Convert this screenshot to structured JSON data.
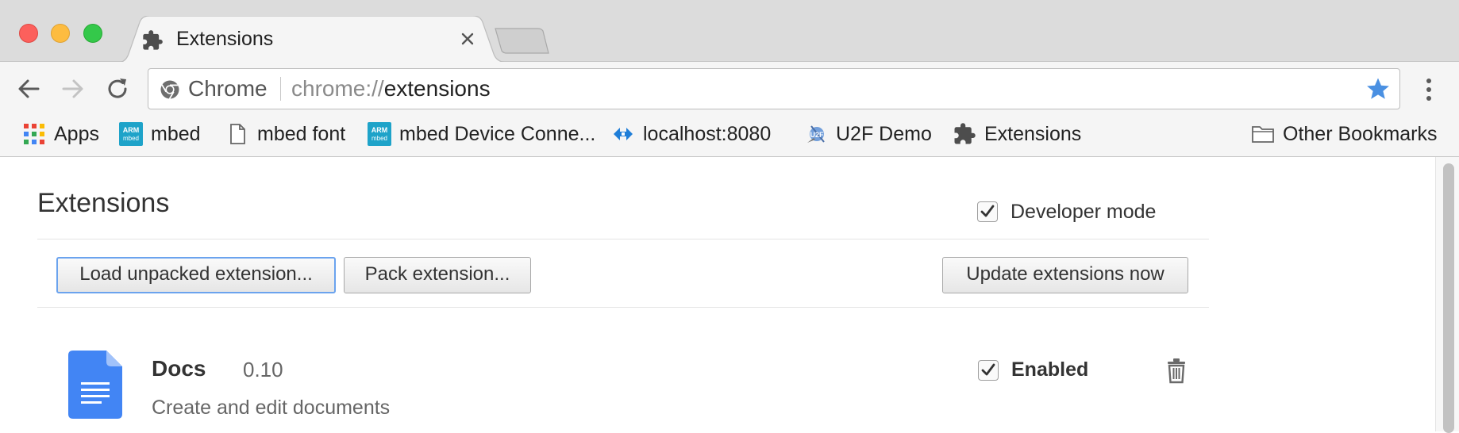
{
  "window": {
    "tab_title": "Extensions"
  },
  "toolbar": {
    "omnibox_chip": "Chrome",
    "url_scheme": "chrome://",
    "url_host": "extensions"
  },
  "bookmarks": [
    {
      "label": "Apps",
      "icon": "apps-grid-icon"
    },
    {
      "label": "mbed",
      "icon": "arm-mbed-icon"
    },
    {
      "label": "mbed font",
      "icon": "document-icon"
    },
    {
      "label": "mbed Device Conne...",
      "icon": "arm-mbed-icon"
    },
    {
      "label": "localhost:8080",
      "icon": "diamond-arrows-icon"
    },
    {
      "label": "U2F Demo",
      "icon": "u2f-icon"
    },
    {
      "label": "Extensions",
      "icon": "puzzle-icon"
    }
  ],
  "other_bookmarks": "Other Bookmarks",
  "page": {
    "title": "Extensions",
    "developer_mode_label": "Developer mode",
    "developer_mode_checked": true,
    "buttons": {
      "load_unpacked": "Load unpacked extension...",
      "pack": "Pack extension...",
      "update": "Update extensions now"
    }
  },
  "extensions": [
    {
      "name": "Docs",
      "version": "0.10",
      "description": "Create and edit documents",
      "enabled_label": "Enabled",
      "enabled": true
    }
  ],
  "colors": {
    "star": "#4a90e2",
    "docs_blue": "#4285f4",
    "focus_ring": "#6ba3ee"
  }
}
